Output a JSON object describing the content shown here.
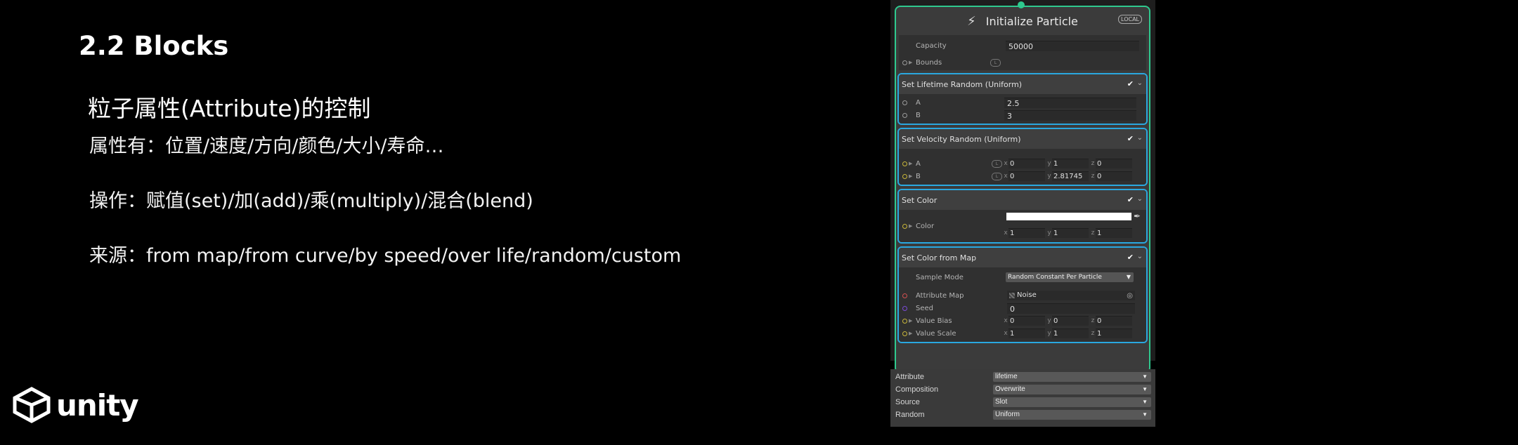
{
  "slide": {
    "title": "2.2 Blocks",
    "subtitle": "粒子属性(Attribute)的控制",
    "bullets": [
      "属性有：位置/速度/方向/颜色/大小/寿命…",
      "操作：赋值(set)/加(add)/乘(multiply)/混合(blend)",
      "来源：from map/from curve/by speed/over life/random/custom"
    ],
    "logo_text": "unity"
  },
  "context": {
    "title": "Initialize Particle",
    "badge": "LOCAL",
    "capacity_label": "Capacity",
    "capacity_value": "50000",
    "bounds_label": "Bounds",
    "local_badge": "L"
  },
  "blocks": {
    "lifetime": {
      "title": "Set Lifetime Random (Uniform)",
      "a_label": "A",
      "a_value": "2.5",
      "b_label": "B",
      "b_value": "3"
    },
    "velocity": {
      "title": "Set Velocity Random (Uniform)",
      "a_label": "A",
      "b_label": "B",
      "a": {
        "x": "0",
        "y": "1",
        "z": "0"
      },
      "b": {
        "x": "0",
        "y": "2.81745",
        "z": "0"
      }
    },
    "color": {
      "title": "Set Color",
      "label": "Color",
      "swatch": "#ffffff",
      "v": {
        "x": "1",
        "y": "1",
        "z": "1"
      }
    },
    "color_map": {
      "title": "Set Color from Map",
      "sample_mode_label": "Sample Mode",
      "sample_mode_value": "Random Constant Per Particle",
      "attribute_map_label": "Attribute Map",
      "attribute_map_value": "Noise",
      "seed_label": "Seed",
      "seed_value": "0",
      "value_bias_label": "Value Bias",
      "value_bias": {
        "x": "0",
        "y": "0",
        "z": "0"
      },
      "value_scale_label": "Value Scale",
      "value_scale": {
        "x": "1",
        "y": "1",
        "z": "1"
      }
    }
  },
  "axes": {
    "x": "x",
    "y": "y",
    "z": "z"
  },
  "settings": [
    {
      "label": "Attribute",
      "value": "lifetime"
    },
    {
      "label": "Composition",
      "value": "Overwrite"
    },
    {
      "label": "Source",
      "value": "Slot"
    },
    {
      "label": "Random",
      "value": "Uniform"
    }
  ],
  "colors": {
    "context_border": "#2fc98e",
    "block_border": "#2aa8e0",
    "port_float": "#c8b63a"
  },
  "icons": [
    "bolt-icon",
    "checkmark-icon",
    "chevron-down-icon",
    "eyedropper-icon",
    "target-icon",
    "unity-logo-icon"
  ]
}
